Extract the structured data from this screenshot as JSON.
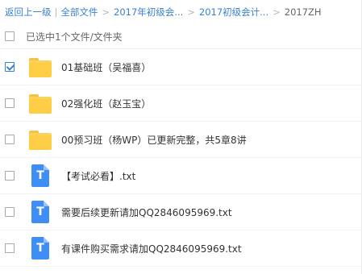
{
  "breadcrumb": {
    "back": "返回上一级",
    "separator_bar": "|",
    "all_files": "全部文件",
    "separator": ">",
    "level1": "2017年初级会...",
    "level2": "2017初级会计...",
    "current": "2017ZH"
  },
  "selection": {
    "label": "已选中1个文件/文件夹",
    "all_checked": false
  },
  "files": [
    {
      "name": "01基础班（吴福喜）",
      "type": "folder",
      "icon": "folder-icon",
      "checked": true
    },
    {
      "name": "02强化班（赵玉宝）",
      "type": "folder",
      "icon": "folder-icon",
      "checked": false
    },
    {
      "name": "00预习班（杨WP）已更新完整，共5章8讲",
      "type": "folder",
      "icon": "folder-icon",
      "checked": false
    },
    {
      "name": "【考试必看】.txt",
      "type": "txt",
      "icon": "text-file-icon",
      "icon_letter": "T",
      "checked": false
    },
    {
      "name": "需要后续更新请加QQ2846095969.txt",
      "type": "txt",
      "icon": "text-file-icon",
      "icon_letter": "T",
      "checked": false
    },
    {
      "name": "有课件购买需求请加QQ2846095969.txt",
      "type": "txt",
      "icon": "text-file-icon",
      "icon_letter": "T",
      "checked": false
    }
  ],
  "colors": {
    "link": "#3a7fd5",
    "folder": "#fcd35a",
    "text_file": "#3f8ef5"
  }
}
